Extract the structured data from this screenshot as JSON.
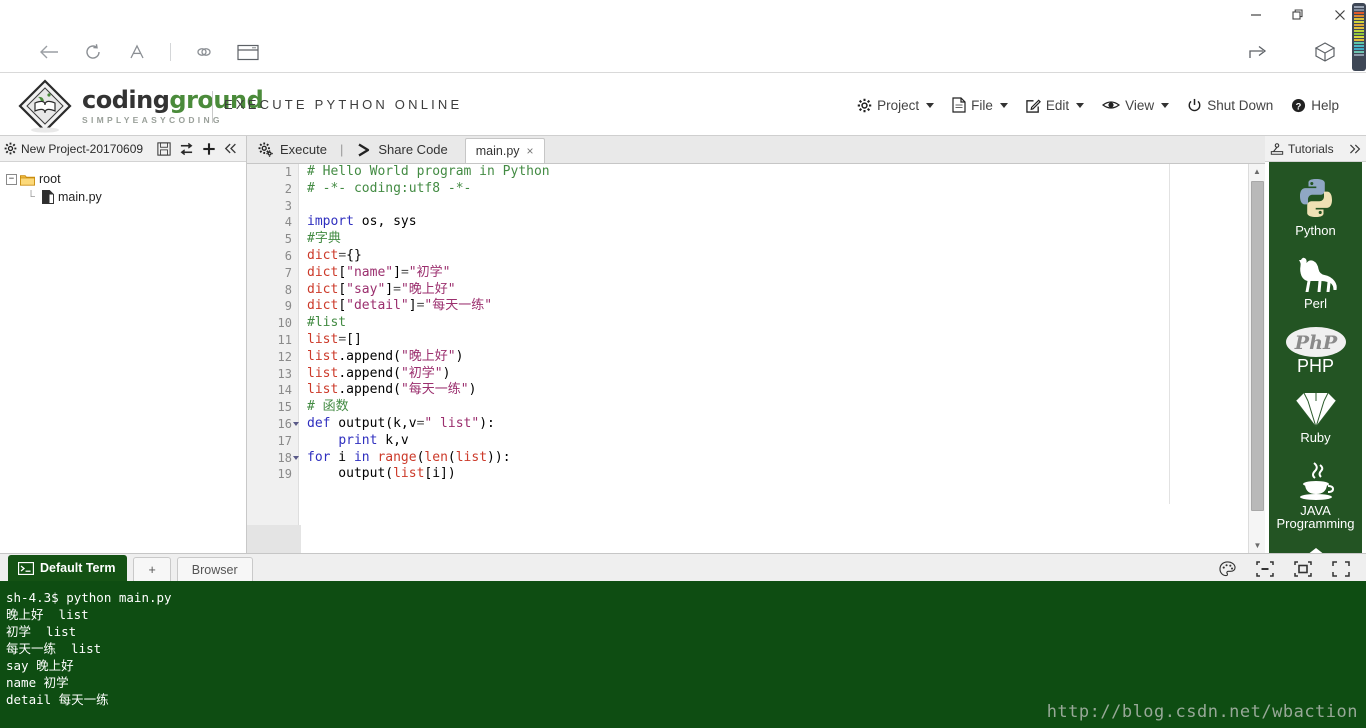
{
  "browser": {
    "window_controls": [
      {
        "name": "minimize",
        "glyph": "–"
      },
      {
        "name": "maximize",
        "glyph": "❐"
      },
      {
        "name": "close",
        "glyph": "✕"
      }
    ],
    "toolbar_left": [
      "back-arrow-icon",
      "reload-icon",
      "font-size-icon",
      "divider",
      "link-icon",
      "window-icon"
    ],
    "toolbar_right": [
      "share-icon",
      "cube-icon"
    ]
  },
  "header": {
    "logo_primary": "coding",
    "logo_accent": "ground",
    "logo_sub": "SIMPLYEASYCODING",
    "tagline": "EXECUTE PYTHON ONLINE",
    "menu": [
      {
        "label": "Project",
        "icon": "gear-icon",
        "caret": true
      },
      {
        "label": "File",
        "icon": "document-icon",
        "caret": true
      },
      {
        "label": "Edit",
        "icon": "pencil-square-icon",
        "caret": true
      },
      {
        "label": "View",
        "icon": "eye-icon",
        "caret": true
      },
      {
        "label": "Shut Down",
        "icon": "power-icon",
        "caret": false
      },
      {
        "label": "Help",
        "icon": "question-circle-icon",
        "caret": false
      }
    ]
  },
  "project": {
    "name": "New Project-20170609",
    "tools": [
      "save-icon",
      "refresh-icon",
      "add-icon",
      "collapse-icon"
    ],
    "tree": [
      {
        "label": "root",
        "type": "folder",
        "depth": 0,
        "expanded": true
      },
      {
        "label": "main.py",
        "type": "file",
        "depth": 1
      }
    ]
  },
  "editor": {
    "actions": [
      {
        "label": "Execute",
        "icon": "gears-icon"
      },
      {
        "label": "|",
        "icon": "separator"
      },
      {
        "label": "Share Code",
        "icon": "share-arrow-icon"
      }
    ],
    "tab": {
      "label": "main.py",
      "close": "×"
    },
    "lines": [
      {
        "n": 1,
        "fold": false,
        "tokens": [
          {
            "t": "cmt",
            "s": "# Hello World program in Python"
          }
        ]
      },
      {
        "n": 2,
        "fold": false,
        "tokens": [
          {
            "t": "cmt",
            "s": "# -*- coding:utf8 -*-"
          }
        ]
      },
      {
        "n": 3,
        "fold": false,
        "tokens": []
      },
      {
        "n": 4,
        "fold": false,
        "tokens": [
          {
            "t": "kw",
            "s": "import"
          },
          {
            "t": "pl",
            "s": " os, sys"
          }
        ]
      },
      {
        "n": 5,
        "fold": false,
        "tokens": [
          {
            "t": "cmt",
            "s": "#字典"
          }
        ]
      },
      {
        "n": 6,
        "fold": false,
        "tokens": [
          {
            "t": "bi",
            "s": "dict"
          },
          {
            "t": "op",
            "s": "="
          },
          {
            "t": "pl",
            "s": "{}"
          }
        ]
      },
      {
        "n": 7,
        "fold": false,
        "tokens": [
          {
            "t": "bi",
            "s": "dict"
          },
          {
            "t": "pl",
            "s": "["
          },
          {
            "t": "dq",
            "s": "\"name\""
          },
          {
            "t": "pl",
            "s": "]"
          },
          {
            "t": "op",
            "s": "="
          },
          {
            "t": "dq",
            "s": "\"初学\""
          }
        ]
      },
      {
        "n": 8,
        "fold": false,
        "tokens": [
          {
            "t": "bi",
            "s": "dict"
          },
          {
            "t": "pl",
            "s": "["
          },
          {
            "t": "dq",
            "s": "\"say\""
          },
          {
            "t": "pl",
            "s": "]"
          },
          {
            "t": "op",
            "s": "="
          },
          {
            "t": "dq",
            "s": "\"晚上好\""
          }
        ]
      },
      {
        "n": 9,
        "fold": false,
        "tokens": [
          {
            "t": "bi",
            "s": "dict"
          },
          {
            "t": "pl",
            "s": "["
          },
          {
            "t": "dq",
            "s": "\"detail\""
          },
          {
            "t": "pl",
            "s": "]"
          },
          {
            "t": "op",
            "s": "="
          },
          {
            "t": "dq",
            "s": "\"每天一练\""
          }
        ]
      },
      {
        "n": 10,
        "fold": false,
        "tokens": [
          {
            "t": "cmt",
            "s": "#list"
          }
        ]
      },
      {
        "n": 11,
        "fold": false,
        "tokens": [
          {
            "t": "bi",
            "s": "list"
          },
          {
            "t": "op",
            "s": "="
          },
          {
            "t": "pl",
            "s": "[]"
          }
        ]
      },
      {
        "n": 12,
        "fold": false,
        "tokens": [
          {
            "t": "bi",
            "s": "list"
          },
          {
            "t": "pl",
            "s": ".append("
          },
          {
            "t": "dq",
            "s": "\"晚上好\""
          },
          {
            "t": "pl",
            "s": ")"
          }
        ]
      },
      {
        "n": 13,
        "fold": false,
        "tokens": [
          {
            "t": "bi",
            "s": "list"
          },
          {
            "t": "pl",
            "s": ".append("
          },
          {
            "t": "dq",
            "s": "\"初学\""
          },
          {
            "t": "pl",
            "s": ")"
          }
        ]
      },
      {
        "n": 14,
        "fold": false,
        "tokens": [
          {
            "t": "bi",
            "s": "list"
          },
          {
            "t": "pl",
            "s": ".append("
          },
          {
            "t": "dq",
            "s": "\"每天一练\""
          },
          {
            "t": "pl",
            "s": ")"
          }
        ]
      },
      {
        "n": 15,
        "fold": false,
        "tokens": [
          {
            "t": "cmt",
            "s": "# 函数"
          }
        ]
      },
      {
        "n": 16,
        "fold": true,
        "tokens": [
          {
            "t": "kw",
            "s": "def"
          },
          {
            "t": "pl",
            "s": " output(k,v"
          },
          {
            "t": "op",
            "s": "="
          },
          {
            "t": "dq",
            "s": "\" list\""
          },
          {
            "t": "pl",
            "s": "):"
          }
        ]
      },
      {
        "n": 17,
        "fold": false,
        "tokens": [
          {
            "t": "pl",
            "s": "    "
          },
          {
            "t": "kw",
            "s": "print"
          },
          {
            "t": "pl",
            "s": " k,v"
          }
        ]
      },
      {
        "n": 18,
        "fold": true,
        "tokens": [
          {
            "t": "kw",
            "s": "for"
          },
          {
            "t": "pl",
            "s": " i "
          },
          {
            "t": "kw",
            "s": "in"
          },
          {
            "t": "pl",
            "s": " "
          },
          {
            "t": "bi",
            "s": "range"
          },
          {
            "t": "pl",
            "s": "("
          },
          {
            "t": "bi",
            "s": "len"
          },
          {
            "t": "pl",
            "s": "("
          },
          {
            "t": "bi",
            "s": "list"
          },
          {
            "t": "pl",
            "s": ")):"
          }
        ]
      },
      {
        "n": 19,
        "fold": false,
        "tokens": [
          {
            "t": "pl",
            "s": "    output("
          },
          {
            "t": "bi",
            "s": "list"
          },
          {
            "t": "pl",
            "s": "[i])"
          }
        ]
      }
    ]
  },
  "tutorials": {
    "title": "Tutorials",
    "expand_icon": "chevron-double-right-icon",
    "items": [
      {
        "label": "Python",
        "icon": "python-logo-icon"
      },
      {
        "label": "Perl",
        "icon": "camel-logo-icon"
      },
      {
        "label": "PHP",
        "icon": "php-logo-icon"
      },
      {
        "label": "Ruby",
        "icon": "ruby-gem-icon"
      },
      {
        "label": "JAVA Programming",
        "icon": "java-coffee-icon"
      }
    ]
  },
  "terminal": {
    "active_tab": "Default Term",
    "add_tab": "+",
    "browser_tab": "Browser",
    "tools": [
      "palette-icon",
      "minimize-icon",
      "restore-icon",
      "fullscreen-icon"
    ],
    "output": [
      "sh-4.3$ python main.py",
      "晚上好  list",
      "初学  list",
      "每天一练  list",
      "say 晚上好",
      "name 初学",
      "detail 每天一练"
    ],
    "watermark": "http://blog.csdn.net/wbaction"
  },
  "colors": {
    "brand_green": "#4b8b3b",
    "terminal_bg": "#0e4d12",
    "tutorials_bg": "#235423",
    "comment": "#438b43",
    "keyword": "#2f2fbf",
    "builtin": "#cc3a2a",
    "string": "#9b2f6e"
  }
}
